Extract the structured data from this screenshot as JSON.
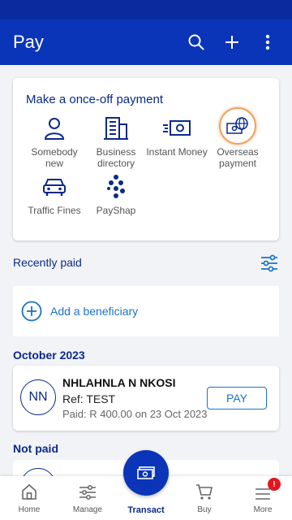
{
  "app_bar": {
    "title": "Pay"
  },
  "pay_card": {
    "title": "Make a once-off payment",
    "options": [
      {
        "label": "Somebody new",
        "icon": "person-icon"
      },
      {
        "label": "Business directory",
        "icon": "building-icon"
      },
      {
        "label": "Instant Money",
        "icon": "money-icon"
      },
      {
        "label": "Overseas payment",
        "icon": "globe-money-icon"
      },
      {
        "label": "Traffic Fines",
        "icon": "car-icon"
      },
      {
        "label": "PayShap",
        "icon": "payshap-icon"
      }
    ]
  },
  "recently_paid": {
    "title": "Recently paid",
    "add_label": "Add a beneficiary"
  },
  "groups": {
    "october": {
      "title": "October 2023",
      "beneficiary": {
        "initials": "NN",
        "name": "NHLAHNLA N NKOSI",
        "ref": "Ref: TEST",
        "paid": "Paid: R 400.00 on 23 Oct 2023",
        "pay_label": "PAY"
      }
    },
    "not_paid": {
      "title": "Not paid"
    }
  },
  "bottom_nav": {
    "items": [
      {
        "label": "Home",
        "icon": "home-icon"
      },
      {
        "label": "Manage",
        "icon": "sliders-icon"
      },
      {
        "label": "Transact",
        "icon": "cash-icon",
        "active": true
      },
      {
        "label": "Buy",
        "icon": "cart-icon"
      },
      {
        "label": "More",
        "icon": "menu-icon",
        "badge": "!"
      }
    ]
  },
  "colors": {
    "primary": "#0a35b8",
    "accent": "#1a73c9",
    "heading": "#0a2a8a",
    "badge": "#e8141c"
  }
}
